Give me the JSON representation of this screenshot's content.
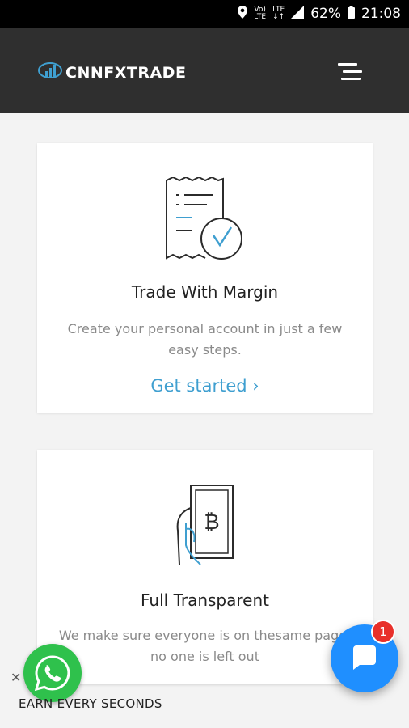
{
  "status_bar": {
    "signal_text_top": "Vo)",
    "signal_text_bottom": "LTE",
    "lte_top": "LTE",
    "lte_bottom": "↓↑",
    "battery_percent": "62%",
    "time": "21:08"
  },
  "header": {
    "logo_text": "CNNFXTRADE"
  },
  "cards": [
    {
      "title": "Trade With Margin",
      "description": "Create your personal account in just a few easy steps.",
      "link_label": "Get started ›"
    },
    {
      "title": "Full Transparent",
      "description": "We make sure everyone is on thesame page, no one is left out"
    }
  ],
  "whatsapp": {
    "close_label": "✕"
  },
  "bottom_text": "EARN EVERY SECONDS",
  "chat": {
    "badge_count": "1"
  },
  "colors": {
    "header_bg": "#2f2f2f",
    "link": "#3f9fd0",
    "whatsapp": "#2fc14c",
    "chat": "#1f8fff",
    "badge": "#e8302a"
  }
}
